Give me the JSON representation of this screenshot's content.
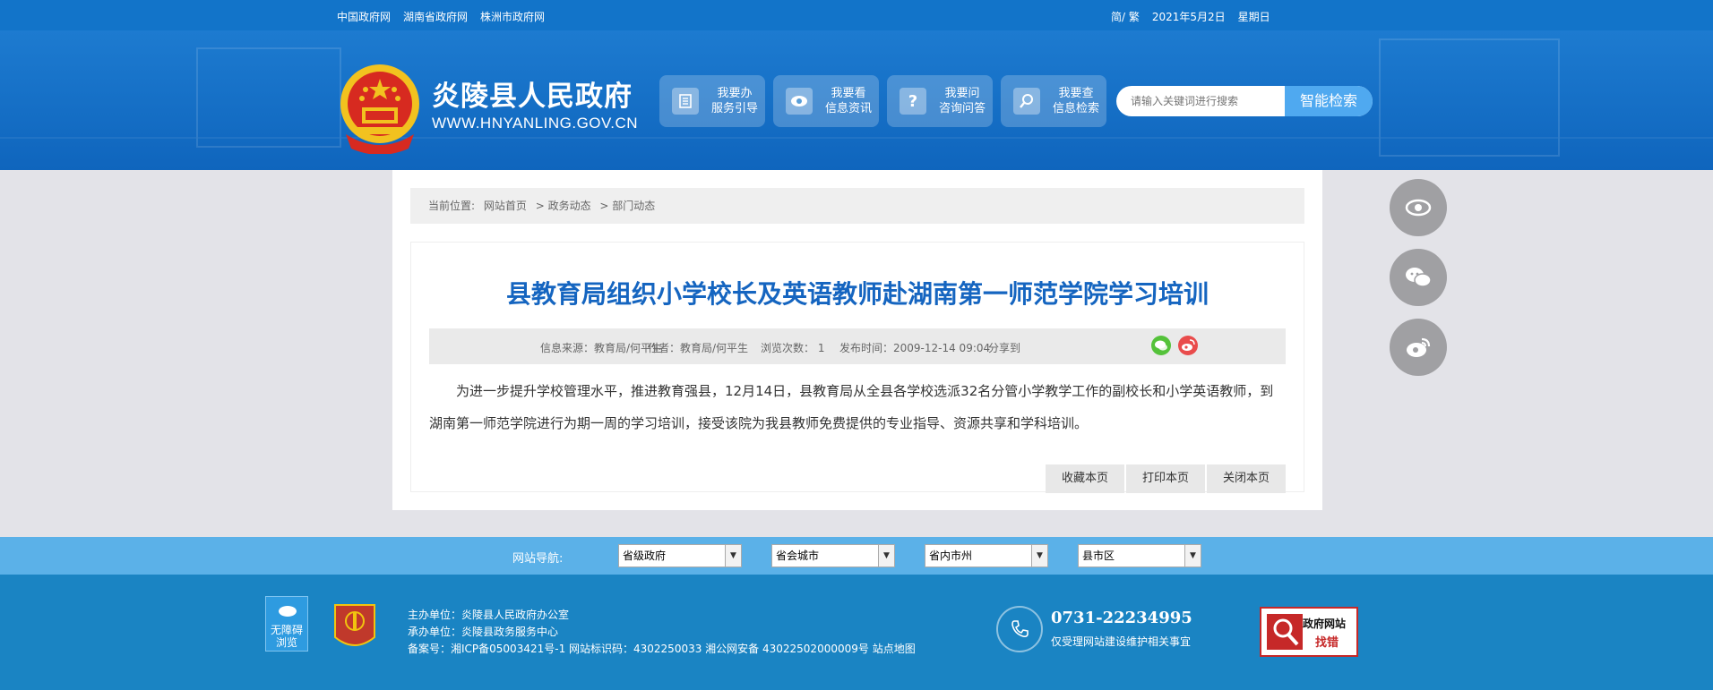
{
  "topbar": {
    "links": [
      "中国政府网",
      "湖南省政府网",
      "株洲市政府网"
    ],
    "lang": "简/ 繁",
    "date": "2021年5月2日",
    "weekday": "星期日"
  },
  "header": {
    "title": "炎陵县人民政府",
    "url": "WWW.HNYANLING.GOV.CN",
    "quick": [
      {
        "line1": "我要办",
        "line2": "服务引导",
        "icon": "guide-icon"
      },
      {
        "line1": "我要看",
        "line2": "信息资讯",
        "icon": "eye-icon"
      },
      {
        "line1": "我要问",
        "line2": "咨询问答",
        "icon": "question-icon"
      },
      {
        "line1": "我要查",
        "line2": "信息检索",
        "icon": "search-icon"
      }
    ],
    "search": {
      "placeholder": "请输入关键词进行搜索",
      "button": "智能检索"
    }
  },
  "breadcrumb": {
    "label": "当前位置:",
    "items": [
      "网站首页",
      "> 政务动态",
      "> 部门动态"
    ]
  },
  "article": {
    "title": "县教育局组织小学校长及英语教师赴湖南第一师范学院学习培训",
    "source": "信息来源：教育局/何平生",
    "author": "作者：教育局/何平生",
    "views": "浏览次数：  1",
    "published": "发布时间：2009-12-14 09:04",
    "share": "分享到",
    "body": "为进一步提升学校管理水平，推进教育强县，12月14日，县教育局从全县各学校选派32名分管小学教学工作的副校长和小学英语教师，到湖南第一师范学院进行为期一周的学习培训，接受该院为我县教师免费提供的专业指导、资源共享和学科培训。",
    "actions": [
      "收藏本页",
      "打印本页",
      "关闭本页"
    ]
  },
  "nav": {
    "label": "网站导航:",
    "selects": [
      "省级政府",
      "省会城市",
      "省内市州",
      "县市区"
    ]
  },
  "footer": {
    "accessibility": "无障碍浏览",
    "accessibility_l1": "无障碍",
    "accessibility_l2": "浏览",
    "party_label": "党政机关",
    "sponsor": "主办单位：炎陵县人民政府办公室",
    "organizer": "承办单位：炎陵县政务服务中心",
    "record": "备案号：湘ICP备05003421号-1  网站标识码：4302250033  湘公网安备 43022502000009号  站点地图",
    "phone": "0731-22234995",
    "phone_desc": "仅受理网站建设维护相关事宜",
    "error_t1": "政府网站",
    "error_t2": "找错"
  },
  "colors": {
    "primary": "#1274c9",
    "title_blue": "#1565c0",
    "nav_blue": "#5bb1e8",
    "footer_blue": "#1a84c3"
  }
}
